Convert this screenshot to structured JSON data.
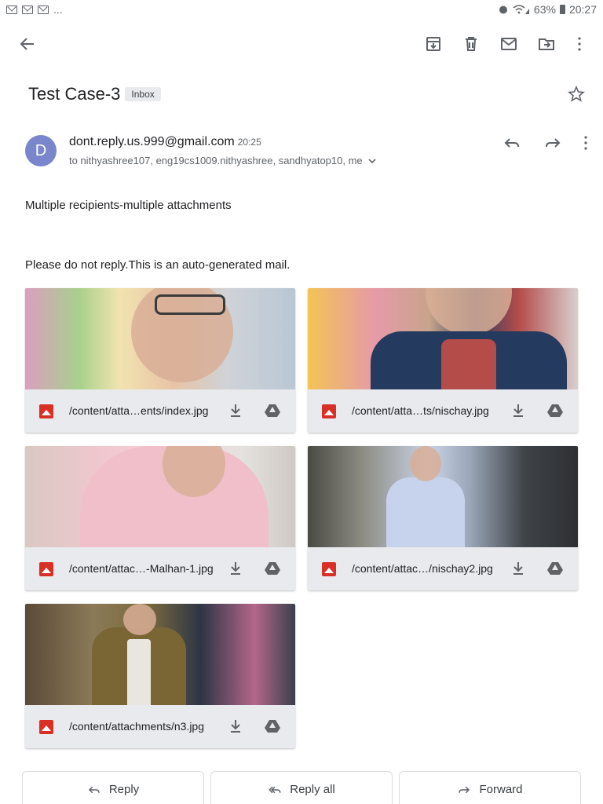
{
  "status_bar": {
    "notifications": "...",
    "battery": "63%",
    "time": "20:27"
  },
  "toolbar": {
    "back_icon": "arrow-left-icon",
    "archive_icon": "archive-icon",
    "delete_icon": "trash-icon",
    "mark_unread_icon": "mail-icon",
    "move_icon": "move-to-folder-icon",
    "more_icon": "more-vertical-icon"
  },
  "email": {
    "subject": "Test Case-3",
    "label": "Inbox",
    "avatar_letter": "D",
    "avatar_color": "#7986cb",
    "sender": "dont.reply.us.999@gmail.com",
    "time": "20:25",
    "recipients": "to nithyashree107, eng19cs1009.nithyashree, sandhyatop10, me",
    "body_line1": "Multiple recipients-multiple attachments",
    "body_line2": "Please do not reply.This is an auto-generated mail."
  },
  "attachments": [
    {
      "filename": "/content/atta…ents/index.jpg"
    },
    {
      "filename": "/content/atta…ts/nischay.jpg"
    },
    {
      "filename": "/content/attac…-Malhan-1.jpg"
    },
    {
      "filename": "/content/attac…/nischay2.jpg"
    },
    {
      "filename": "/content/attachments/n3.jpg"
    }
  ],
  "reply_bar": {
    "reply": "Reply",
    "reply_all": "Reply all",
    "forward": "Forward"
  },
  "colors": {
    "accent_red": "#d93025",
    "icon_gray": "#5f6368"
  }
}
